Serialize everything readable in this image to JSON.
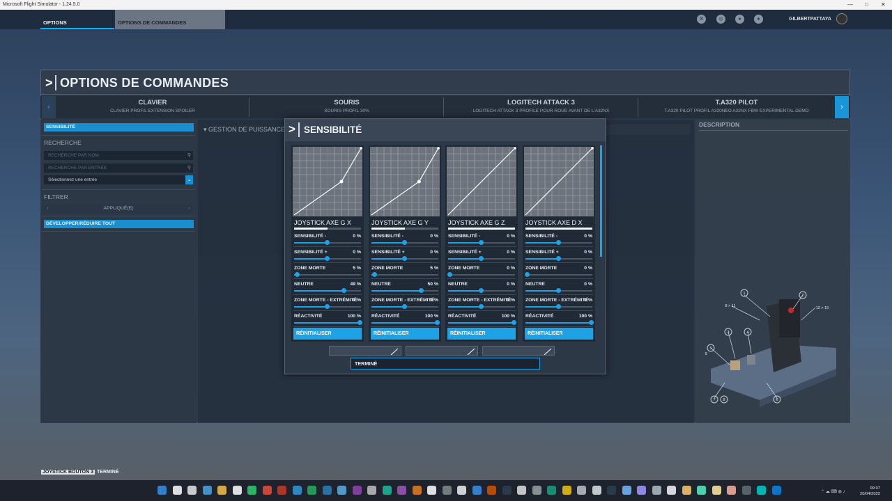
{
  "window": {
    "title": "Microsoft Flight Simulator - 1.24.5.0",
    "controls": [
      "—",
      "□",
      "✕"
    ]
  },
  "topbar": {
    "tab_options": "OPTIONS",
    "tab_commandes": "OPTIONS DE COMMANDES",
    "username": "GILBERTPATTAYA",
    "icons": [
      "settings-icon",
      "activity-icon",
      "profile-icon",
      "notifications-icon"
    ]
  },
  "page": {
    "title": "OPTIONS DE COMMANDES"
  },
  "devices": [
    {
      "name": "CLAVIER",
      "profile": "CLAVIER PROFIL EXTENSION SPOILER"
    },
    {
      "name": "SOURIS",
      "profile": "SOURIS PROFIL 30%"
    },
    {
      "name": "LOGITECH ATTACK 3",
      "profile": "LOGITECH ATTACK 3 PROFILE POUR ROUE AVANT DE L'A32NX"
    },
    {
      "name": "T.A320 PILOT",
      "profile": "T.A320 PILOT PROFIL A320NEO A32NX FBW EXPERIMENTAL DEMO"
    }
  ],
  "left": {
    "sensibilite": "SENSIBILITÉ",
    "recherche": "RECHERCHE",
    "search_name_placeholder": "RECHERCHE PAR NOM",
    "search_input_placeholder": "RECHERCHE PAR ENTRÉE",
    "select_input": "Sélectionnez une entrée",
    "filtrer": "FILTRER",
    "filter_value": "APPLIQUÉ(E)",
    "expand": "DÉVELOPPER/RÉDUIRE TOUT"
  },
  "center": {
    "gestion": "GESTION DE PUISSANCE"
  },
  "right": {
    "description": "DESCRIPTION"
  },
  "throttle_callouts": [
    "1",
    "2",
    "3",
    "4",
    "5",
    "6",
    "7",
    "8",
    "9",
    "8 > 11",
    "12 > 15"
  ],
  "modal": {
    "title": "SENSIBILITÉ",
    "row_labels": [
      "SENSIBILITÉ -",
      "SENSIBILITÉ +",
      "ZONE MORTE",
      "NEUTRE",
      "ZONE MORTE - EXTRÉMITÉ",
      "RÉACTIVITÉ"
    ],
    "reset_label": "RÉINITIALISER",
    "done_label": "TERMINÉ",
    "axes": [
      {
        "name": "JOYSTICK AXE G X",
        "bar": 0.5,
        "curve": "kink",
        "values": [
          "0 %",
          "0 %",
          "5 %",
          "49 %",
          "0 %",
          "100 %"
        ],
        "levels": [
          0.5,
          0.5,
          0.05,
          0.745,
          0.5,
          1.0
        ]
      },
      {
        "name": "JOYSTICK AXE G Y",
        "bar": 0.5,
        "curve": "kink",
        "values": [
          "0 %",
          "0 %",
          "5 %",
          "50 %",
          "0 %",
          "100 %"
        ],
        "levels": [
          0.5,
          0.5,
          0.05,
          0.75,
          0.5,
          1.0
        ]
      },
      {
        "name": "JOYSTICK AXE G Z",
        "bar": 1.0,
        "curve": "linear",
        "values": [
          "0 %",
          "0 %",
          "0 %",
          "0 %",
          "0 %",
          "100 %"
        ],
        "levels": [
          0.5,
          0.5,
          0.0,
          0.5,
          0.5,
          1.0
        ]
      },
      {
        "name": "JOYSTICK AXE D X",
        "bar": 1.0,
        "curve": "linear",
        "values": [
          "0 %",
          "0 %",
          "0 %",
          "0 %",
          "0 %",
          "100 %"
        ],
        "levels": [
          0.5,
          0.5,
          0.0,
          0.5,
          0.5,
          1.0
        ]
      }
    ]
  },
  "hint": {
    "key": "JOYSTICK BOUTON 3",
    "action": "TERMINÉ"
  },
  "clock": {
    "time": "09:37",
    "date": "20/04/2022"
  }
}
